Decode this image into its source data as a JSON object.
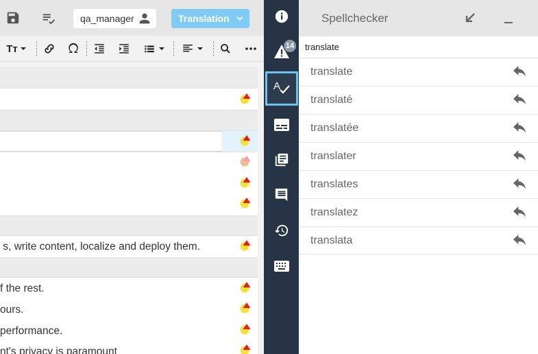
{
  "header": {
    "user": "qa_manager",
    "mode_button": "Translation"
  },
  "toolbar": {
    "text_format_label": "Tт"
  },
  "segments": [
    {
      "text": "",
      "group": true
    },
    {
      "text": "",
      "qa": "warn"
    },
    {
      "text": "",
      "group": true
    },
    {
      "text": "",
      "qa": "warn",
      "active": true
    },
    {
      "text": "",
      "qa": "light"
    },
    {
      "text": "",
      "qa": "warn"
    },
    {
      "text": "",
      "qa": "warn"
    },
    {
      "text": "",
      "group": true
    },
    {
      "text": "s, write content, localize and deploy them.",
      "qa": "warn"
    },
    {
      "text": "",
      "group": true
    },
    {
      "text": "f the rest.",
      "qa": "warn"
    },
    {
      "text": "ours.",
      "qa": "warn"
    },
    {
      "text": "performance.",
      "qa": "warn"
    },
    {
      "text": "nt's privacy is paramount",
      "qa": "warn"
    }
  ],
  "sidenav": {
    "qa_badge": "14",
    "items": [
      "info-icon",
      "warning-icon",
      "spellcheck-icon",
      "subtitles-icon",
      "library-icon",
      "comment-icon",
      "history-icon",
      "keyboard-icon"
    ]
  },
  "spellchecker": {
    "title": "Spellchecker",
    "word": "translate",
    "suggestions": [
      "translate",
      "translaté",
      "translatée",
      "translater",
      "translates",
      "translatez",
      "translata"
    ]
  },
  "colors": {
    "nav_bg": "#263445",
    "accent": "#7fcbf3",
    "qa_yellow": "#f7e03b",
    "qa_red": "#e02020"
  }
}
